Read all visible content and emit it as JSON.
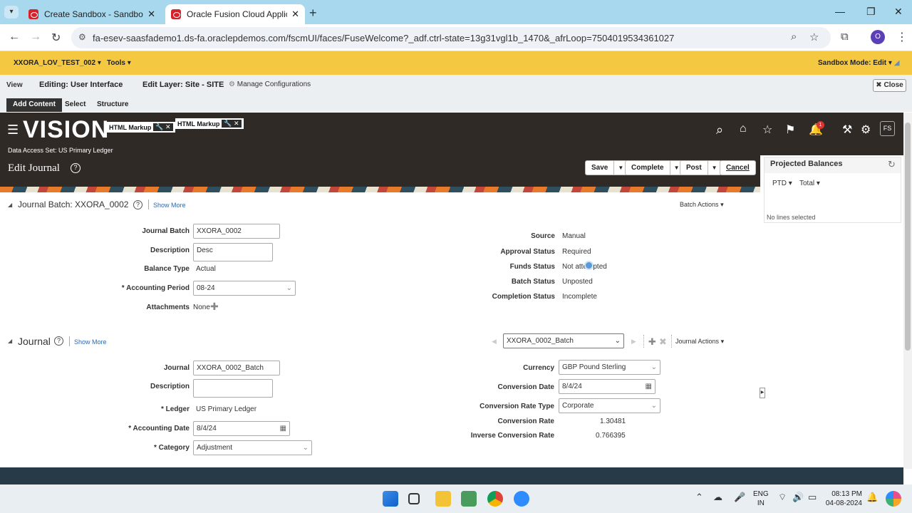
{
  "browser": {
    "tabs": [
      {
        "title": "Create Sandbox - Sandboxes - ..."
      },
      {
        "title": "Oracle Fusion Cloud Applicatio..."
      }
    ],
    "url": "fa-esev-saasfademo1.ds-fa.oraclepdemos.com/fscmUI/faces/FuseWelcome?_adf.ctrl-state=13g31vgl1b_1470&_afrLoop=7504019534361027",
    "profile_initial": "O"
  },
  "sandbox_bar": {
    "name": "XXORA_LOV_TEST_002",
    "tools": "Tools",
    "mode": "Sandbox Mode: Edit"
  },
  "composer": {
    "view": "View",
    "editing": "Editing: User Interface",
    "layer": "Edit Layer: Site - SITE",
    "manage": "Manage Configurations",
    "close": "Close",
    "tabs": [
      "Add Content",
      "Select",
      "Structure"
    ]
  },
  "header": {
    "logo": "VISION",
    "html_markup": "HTML Markup",
    "data_access": "Data Access Set: US Primary Ledger",
    "page_title": "Edit Journal",
    "notif_count": "1",
    "user_initials": "FS",
    "buttons": {
      "save": "Save",
      "complete": "Complete",
      "post": "Post",
      "cancel": "Cancel"
    }
  },
  "projected": {
    "title": "Projected Balances",
    "ptd": "PTD",
    "total": "Total",
    "empty": "No lines selected"
  },
  "batch": {
    "title": "Journal Batch: XXORA_0002",
    "show_more": "Show More",
    "actions": "Batch Actions",
    "journal_batch_label": "Journal Batch",
    "journal_batch": "XXORA_0002",
    "description_label": "Description",
    "description": "Desc",
    "balance_type_label": "Balance Type",
    "balance_type": "Actual",
    "accounting_period_label": "Accounting Period",
    "accounting_period": "08-24",
    "attachments_label": "Attachments",
    "attachments": "None",
    "source_label": "Source",
    "source": "Manual",
    "approval_label": "Approval Status",
    "approval": "Required",
    "funds_label": "Funds Status",
    "funds": "Not attempted",
    "batch_status_label": "Batch Status",
    "batch_status": "Unposted",
    "completion_label": "Completion Status",
    "completion": "Incomplete"
  },
  "journal": {
    "title": "Journal",
    "show_more": "Show More",
    "selector": "XXORA_0002_Batch",
    "actions": "Journal Actions",
    "journal_label": "Journal",
    "journal": "XXORA_0002_Batch",
    "description_label": "Description",
    "ledger_label": "Ledger",
    "ledger": "US Primary Ledger",
    "accounting_date_label": "Accounting Date",
    "accounting_date": "8/4/24",
    "category_label": "Category",
    "category": "Adjustment",
    "currency_label": "Currency",
    "currency": "GBP Pound Sterling",
    "conversion_date_label": "Conversion Date",
    "conversion_date": "8/4/24",
    "rate_type_label": "Conversion Rate Type",
    "rate_type": "Corporate",
    "rate_label": "Conversion Rate",
    "rate": "1.30481",
    "inverse_label": "Inverse Conversion Rate",
    "inverse": "0.766395"
  },
  "taskbar": {
    "lang1": "ENG",
    "lang2": "IN",
    "time": "08:13 PM",
    "date": "04-08-2024"
  }
}
